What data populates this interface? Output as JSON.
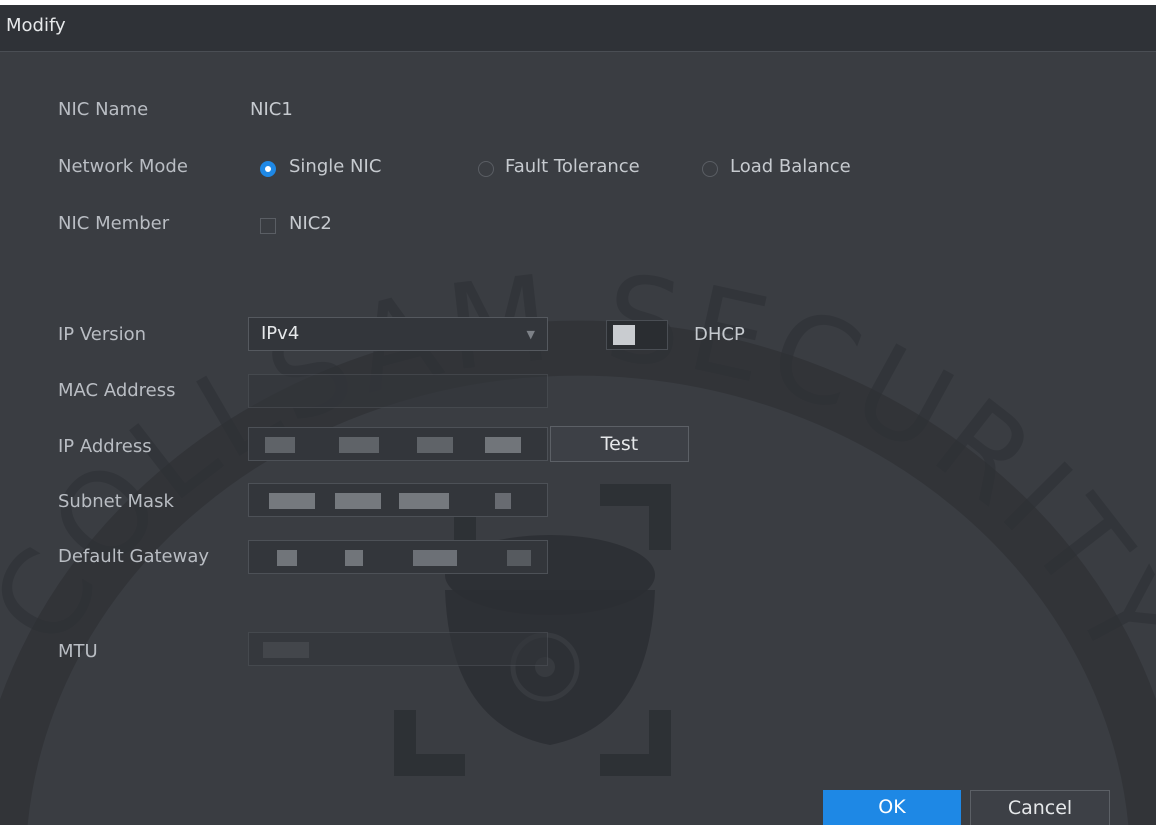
{
  "dialog": {
    "title": "Modify"
  },
  "fields": {
    "nic_name_label": "NIC Name",
    "nic_name_value": "NIC1",
    "network_mode_label": "Network Mode",
    "network_mode_options": [
      "Single NIC",
      "Fault Tolerance",
      "Load Balance"
    ],
    "network_mode_selected": "Single NIC",
    "nic_member_label": "NIC Member",
    "nic_member_option": "NIC2",
    "ip_version_label": "IP Version",
    "ip_version_value": "IPv4",
    "dhcp_label": "DHCP",
    "mac_label": "MAC Address",
    "ip_label": "IP Address",
    "subnet_label": "Subnet Mask",
    "gateway_label": "Default Gateway",
    "mtu_label": "MTU"
  },
  "buttons": {
    "test": "Test",
    "ok": "OK",
    "cancel": "Cancel"
  },
  "watermark": {
    "text": "COLLSAM SECURITY"
  },
  "colors": {
    "accent": "#1e88e5",
    "background": "#3a3d42",
    "titlebar": "#2f3237"
  }
}
